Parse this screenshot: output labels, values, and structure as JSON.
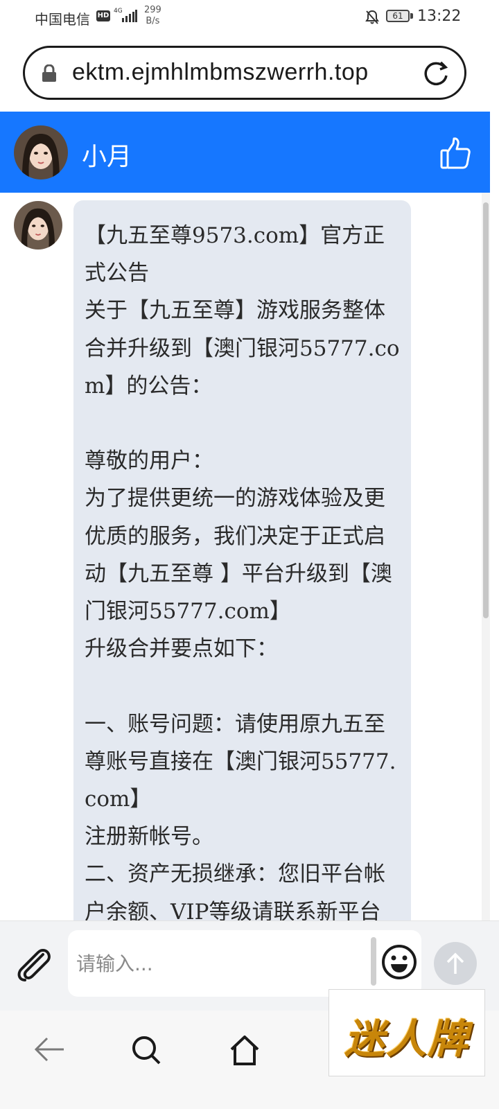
{
  "status_bar": {
    "carrier": "中国电信",
    "hd": "HD",
    "network": "4G",
    "speed_value": "299",
    "speed_unit": "B/s",
    "battery": "61",
    "time": "13:22"
  },
  "browser": {
    "url": "ektm.ejmhlmbmszwerrh.top"
  },
  "chat": {
    "contact_name": "小月",
    "message": "【九五至尊9573.com】官方正式公告\n关于【九五至尊】游戏服务整体合并升级到【澳门银河55777.com】的公告：\n\n尊敬的用户：\n为了提供更统一的游戏体验及更优质的服务，我们决定于正式启动【九五至尊 】平台升级到【澳门银河55777.com】\n升级合并要点如下：\n\n一、账号问题：请使用原九五至尊账号直接在【澳门银河55777.com】\n注册新帐号。\n二、资产无损继承：您旧平台帐户余额、VIP等级请联系新平台"
  },
  "input": {
    "placeholder": "请输入..."
  },
  "watermark": {
    "text": "迷人牌"
  },
  "colors": {
    "header_blue": "#1677ff",
    "bubble_bg": "#e4e9f1"
  }
}
